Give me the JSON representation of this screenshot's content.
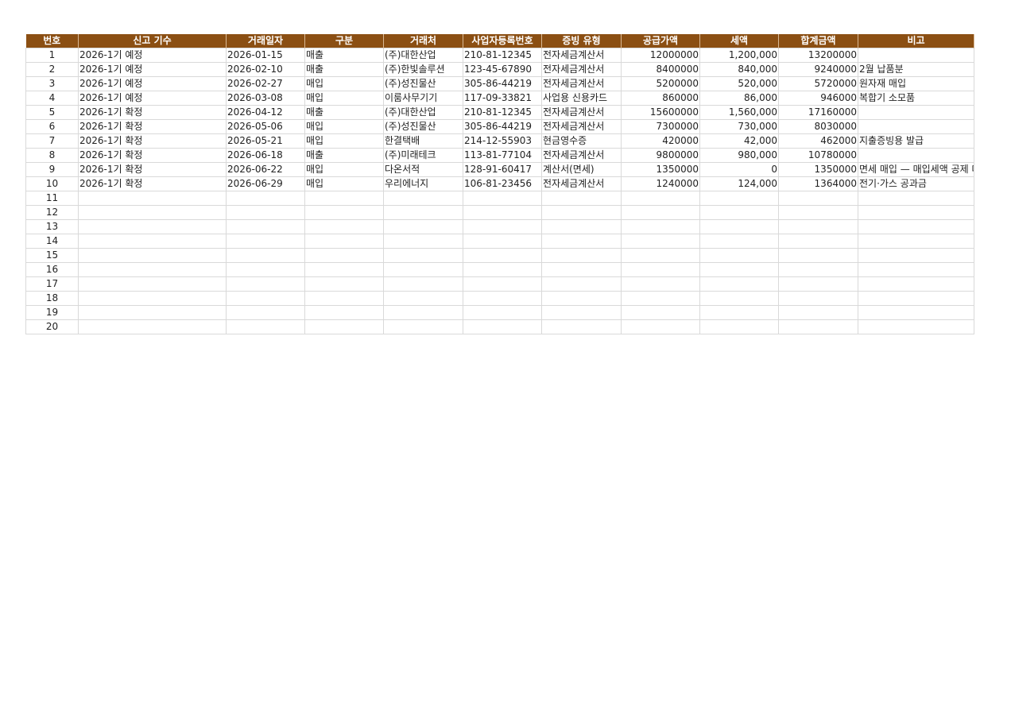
{
  "colors": {
    "header_bg": "#8b4f13",
    "header_text": "#ffffff",
    "grid_line": "#d9d9d9"
  },
  "headers": [
    "번호",
    "신고 기수",
    "거래일자",
    "구분",
    "거래처",
    "사업자등록번호",
    "증빙 유형",
    "공급가액",
    "세액",
    "합계금액",
    "비고"
  ],
  "rows": [
    [
      "1",
      "2026-1기 예정",
      "2026-01-15",
      "매출",
      "(주)대한산업",
      "210-81-12345",
      "전자세금계산서",
      "12000000",
      "1,200,000",
      "13200000",
      ""
    ],
    [
      "2",
      "2026-1기 예정",
      "2026-02-10",
      "매출",
      "(주)한빛솔루션",
      "123-45-67890",
      "전자세금계산서",
      "8400000",
      "840,000",
      "9240000",
      "2월 납품분"
    ],
    [
      "3",
      "2026-1기 예정",
      "2026-02-27",
      "매입",
      "(주)성진물산",
      "305-86-44219",
      "전자세금계산서",
      "5200000",
      "520,000",
      "5720000",
      "원자재 매입"
    ],
    [
      "4",
      "2026-1기 예정",
      "2026-03-08",
      "매입",
      "이룸사무기기",
      "117-09-33821",
      "사업용 신용카드",
      "860000",
      "86,000",
      "946000",
      "복합기 소모품"
    ],
    [
      "5",
      "2026-1기 확정",
      "2026-04-12",
      "매출",
      "(주)대한산업",
      "210-81-12345",
      "전자세금계산서",
      "15600000",
      "1,560,000",
      "17160000",
      ""
    ],
    [
      "6",
      "2026-1기 확정",
      "2026-05-06",
      "매입",
      "(주)성진물산",
      "305-86-44219",
      "전자세금계산서",
      "7300000",
      "730,000",
      "8030000",
      ""
    ],
    [
      "7",
      "2026-1기 확정",
      "2026-05-21",
      "매입",
      "한결택배",
      "214-12-55903",
      "현금영수증",
      "420000",
      "42,000",
      "462000",
      "지출증빙용 발급"
    ],
    [
      "8",
      "2026-1기 확정",
      "2026-06-18",
      "매출",
      "(주)미래테크",
      "113-81-77104",
      "전자세금계산서",
      "9800000",
      "980,000",
      "10780000",
      ""
    ],
    [
      "9",
      "2026-1기 확정",
      "2026-06-22",
      "매입",
      "다온서적",
      "128-91-60417",
      "계산서(면세)",
      "1350000",
      "0",
      "1350000",
      "면세 매입 — 매입세액 공제 대"
    ],
    [
      "10",
      "2026-1기 확정",
      "2026-06-29",
      "매입",
      "우리에너지",
      "106-81-23456",
      "전자세금계산서",
      "1240000",
      "124,000",
      "1364000",
      "전기·가스 공과금"
    ],
    [
      "11",
      "",
      "",
      "",
      "",
      "",
      "",
      "",
      "",
      "",
      ""
    ],
    [
      "12",
      "",
      "",
      "",
      "",
      "",
      "",
      "",
      "",
      "",
      ""
    ],
    [
      "13",
      "",
      "",
      "",
      "",
      "",
      "",
      "",
      "",
      "",
      ""
    ],
    [
      "14",
      "",
      "",
      "",
      "",
      "",
      "",
      "",
      "",
      "",
      ""
    ],
    [
      "15",
      "",
      "",
      "",
      "",
      "",
      "",
      "",
      "",
      "",
      ""
    ],
    [
      "16",
      "",
      "",
      "",
      "",
      "",
      "",
      "",
      "",
      "",
      ""
    ],
    [
      "17",
      "",
      "",
      "",
      "",
      "",
      "",
      "",
      "",
      "",
      ""
    ],
    [
      "18",
      "",
      "",
      "",
      "",
      "",
      "",
      "",
      "",
      "",
      ""
    ],
    [
      "19",
      "",
      "",
      "",
      "",
      "",
      "",
      "",
      "",
      "",
      ""
    ],
    [
      "20",
      "",
      "",
      "",
      "",
      "",
      "",
      "",
      "",
      "",
      ""
    ]
  ]
}
